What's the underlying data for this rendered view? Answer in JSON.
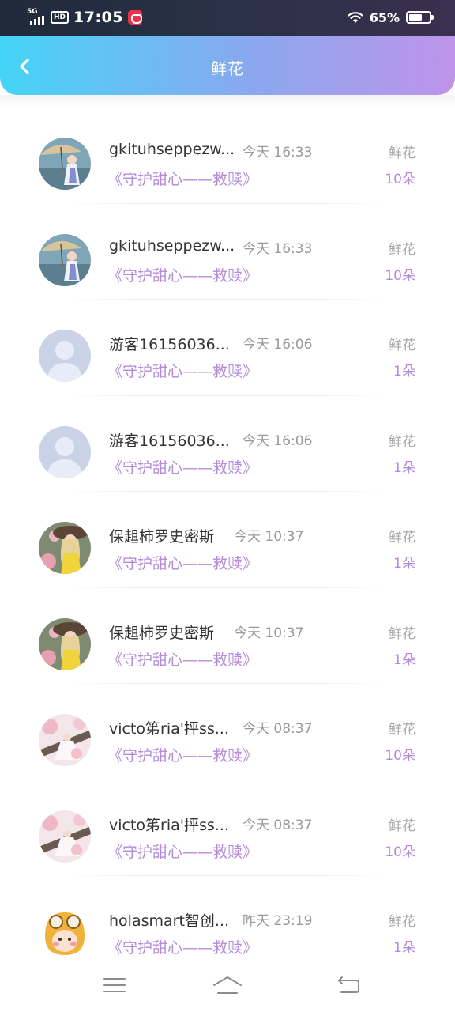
{
  "status_bar": {
    "network": "5G",
    "hd": "HD",
    "time": "17:05",
    "battery_text": "65%",
    "battery_level": 0.65
  },
  "header": {
    "title": "鲜花",
    "back_icon": "chevron-left-icon"
  },
  "records": [
    {
      "name": "gkituhseppezw...",
      "time": "今天 16:33",
      "work": "《守护甜心——救赎》",
      "gift_type": "鲜花",
      "count": "10朵",
      "avatar": "girl-umbrella"
    },
    {
      "name": "gkituhseppezw...",
      "time": "今天 16:33",
      "work": "《守护甜心——救赎》",
      "gift_type": "鲜花",
      "count": "10朵",
      "avatar": "girl-umbrella"
    },
    {
      "name": "游客16156036...",
      "time": "今天 16:06",
      "work": "《守护甜心——救赎》",
      "gift_type": "鲜花",
      "count": "1朵",
      "avatar": "default"
    },
    {
      "name": "游客16156036...",
      "time": "今天 16:06",
      "work": "《守护甜心——救赎》",
      "gift_type": "鲜花",
      "count": "1朵",
      "avatar": "default"
    },
    {
      "name": "保趄柿罗史密斯",
      "time": "今天 10:37",
      "work": "《守护甜心——救赎》",
      "gift_type": "鲜花",
      "count": "1朵",
      "avatar": "girl-hat"
    },
    {
      "name": "保趄柿罗史密斯",
      "time": "今天 10:37",
      "work": "《守护甜心——救赎》",
      "gift_type": "鲜花",
      "count": "1朵",
      "avatar": "girl-hat"
    },
    {
      "name": "victo笫ria'抨ss...",
      "time": "今天 08:37",
      "work": "《守护甜心——救赎》",
      "gift_type": "鲜花",
      "count": "10朵",
      "avatar": "girl-blossom"
    },
    {
      "name": "victo笫ria'抨ss...",
      "time": "今天 08:37",
      "work": "《守护甜心——救赎》",
      "gift_type": "鲜花",
      "count": "10朵",
      "avatar": "girl-blossom"
    },
    {
      "name": "holasmart智创...",
      "time": "昨天 23:19",
      "work": "《守护甜心——救赎》",
      "gift_type": "鲜花",
      "count": "1朵",
      "avatar": "cartoon-goggles"
    }
  ],
  "nav": {
    "menu_icon": "menu-icon",
    "home_icon": "home-icon",
    "back_icon": "return-icon"
  }
}
